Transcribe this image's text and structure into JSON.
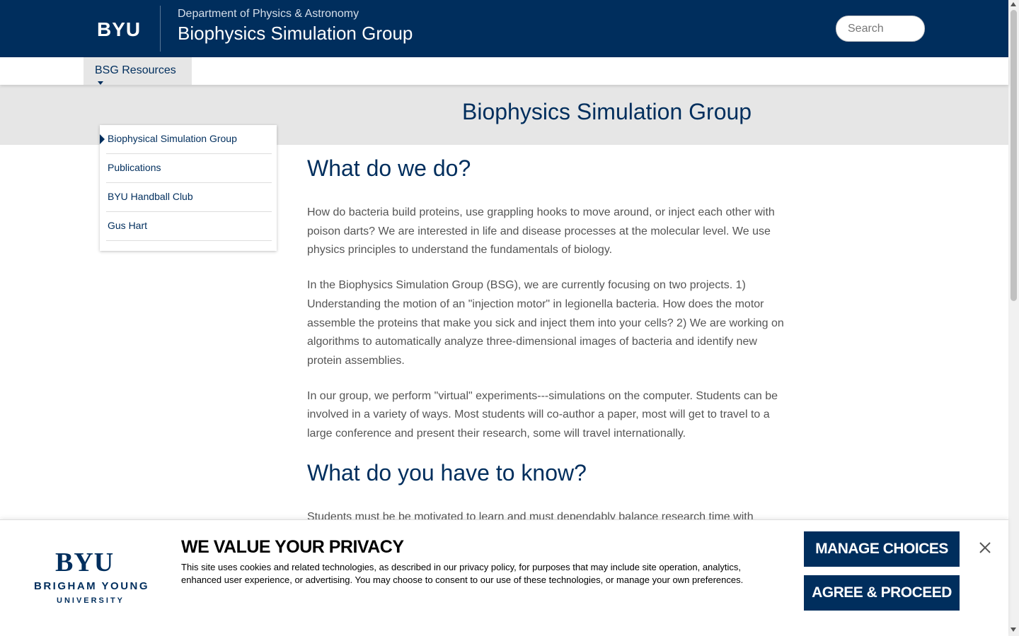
{
  "header": {
    "logo": "BYU",
    "department": "Department of Physics & Astronomy",
    "site_title": "Biophysics Simulation Group",
    "search_placeholder": "Search"
  },
  "nav": {
    "dropdown_label": "BSG Resources"
  },
  "hero": {
    "title": "Biophysics Simulation Group"
  },
  "sidebar": {
    "items": [
      {
        "label": "Biophysical Simulation Group",
        "active": true
      },
      {
        "label": "Publications"
      },
      {
        "label": "BYU Handball Club"
      },
      {
        "label": "Gus Hart"
      }
    ]
  },
  "content": {
    "heading1": "What do we do?",
    "paragraphs": [
      "How do bacteria build proteins, use grappling hooks to move around, or inject each other with poison darts? We are interested in life and disease processes at the molecular level. We use physics principles to understand the fundamentals of biology.",
      "In the Biophysics Simulation Group (BSG), we are currently focusing on two projects. 1) Understanding the motion of an \"injection motor\" in legionella bacteria. How does the motor assemble the proteins that make you sick and inject them into your cells? 2) We are working on algorithms to automatically analyze three-dimensional images of bacteria and identify new protein assemblies.",
      "In our group, we perform \"virtual\" experiments---simulations on the computer. Students can be involved in a variety of ways. Most students will co-author a paper, most will get to travel to a large conference and present their research, some will travel internationally."
    ],
    "heading2": "What do you have to know?",
    "partial_paragraph": "Students must be be motivated to learn and must dependably balance research time with"
  },
  "cookie": {
    "logo": "BYU",
    "logo_line1": "BRIGHAM YOUNG",
    "logo_line2": "UNIVERSITY",
    "title": "WE VALUE YOUR PRIVACY",
    "text": "This site uses cookies and related technologies, as described in our privacy policy, for purposes that may include site operation, analytics, enhanced user experience, or advertising. You may choose to consent to our use of these technologies, or manage your own preferences.",
    "manage_label": "MANAGE CHOICES",
    "agree_label": "AGREE & PROCEED"
  },
  "colors": {
    "brand_navy": "#002e5d",
    "hero_gray": "#e6e6e6"
  }
}
